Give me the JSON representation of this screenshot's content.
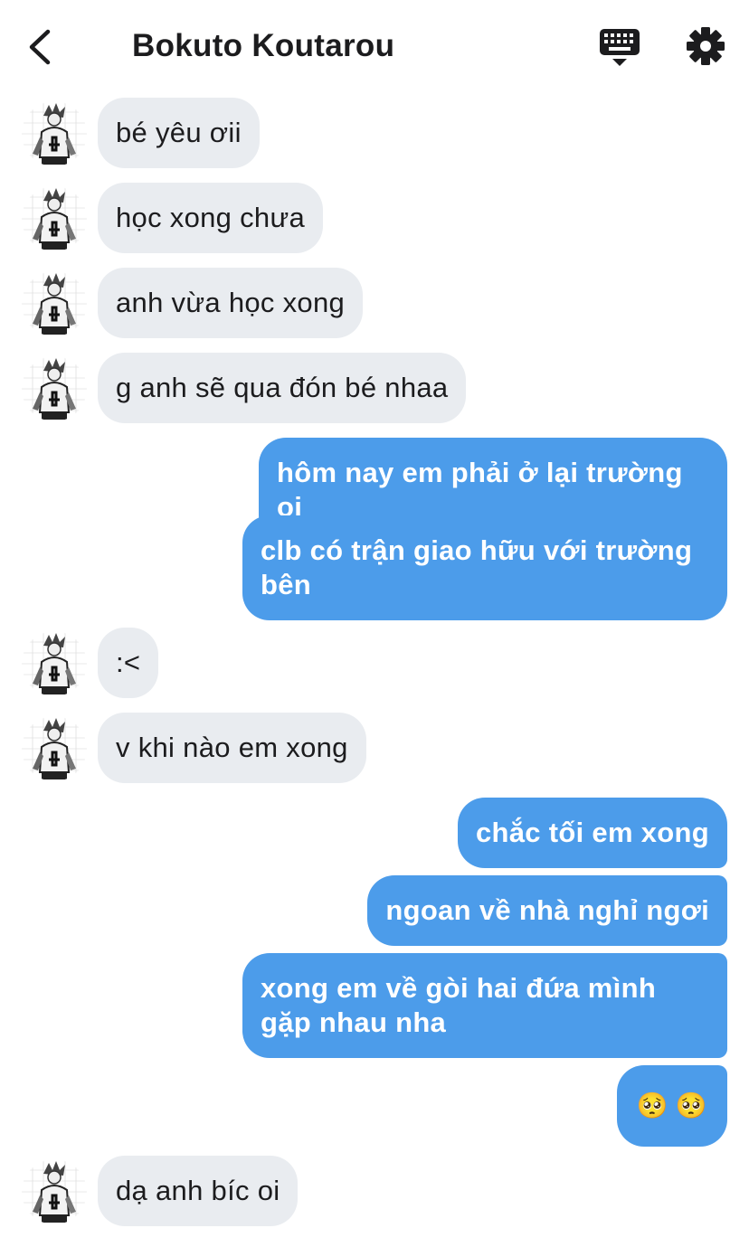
{
  "header": {
    "title": "Bokuto Koutarou",
    "back_icon": "chevron-left-icon",
    "keyboard_icon": "keyboard-icon",
    "settings_icon": "gear-icon"
  },
  "colors": {
    "outgoing_bubble": "#4c9cea",
    "incoming_bubble": "#e9ecf0",
    "text_dark": "#1c1c1e"
  },
  "messages": [
    {
      "sender": "Bokuto Koutarou",
      "text": "bé yêu ơii"
    },
    {
      "sender": "Bokuto Koutarou",
      "text": "học xong chưa"
    },
    {
      "sender": "Bokuto Koutarou",
      "text": "anh vừa học xong"
    },
    {
      "sender": "Bokuto Koutarou",
      "text": "g anh sẽ qua đón bé nhaa"
    },
    {
      "sender": "me",
      "text": "hôm nay em phải ở lại trường oi"
    },
    {
      "sender": "me",
      "text": "clb có trận giao hữu với trường bên"
    },
    {
      "sender": "Bokuto Koutarou",
      "text": ":<"
    },
    {
      "sender": "Bokuto Koutarou",
      "text": "v khi nào em xong"
    },
    {
      "sender": "me",
      "text": "chắc tối em xong"
    },
    {
      "sender": "me",
      "text": "ngoan về nhà nghỉ ngơi"
    },
    {
      "sender": "me",
      "text": "xong em về gòi hai đứa mình gặp nhau nha"
    },
    {
      "sender": "me",
      "text": "🥺 🥺"
    },
    {
      "sender": "Bokuto Koutarou",
      "text": "dạ anh bíc oi"
    }
  ]
}
